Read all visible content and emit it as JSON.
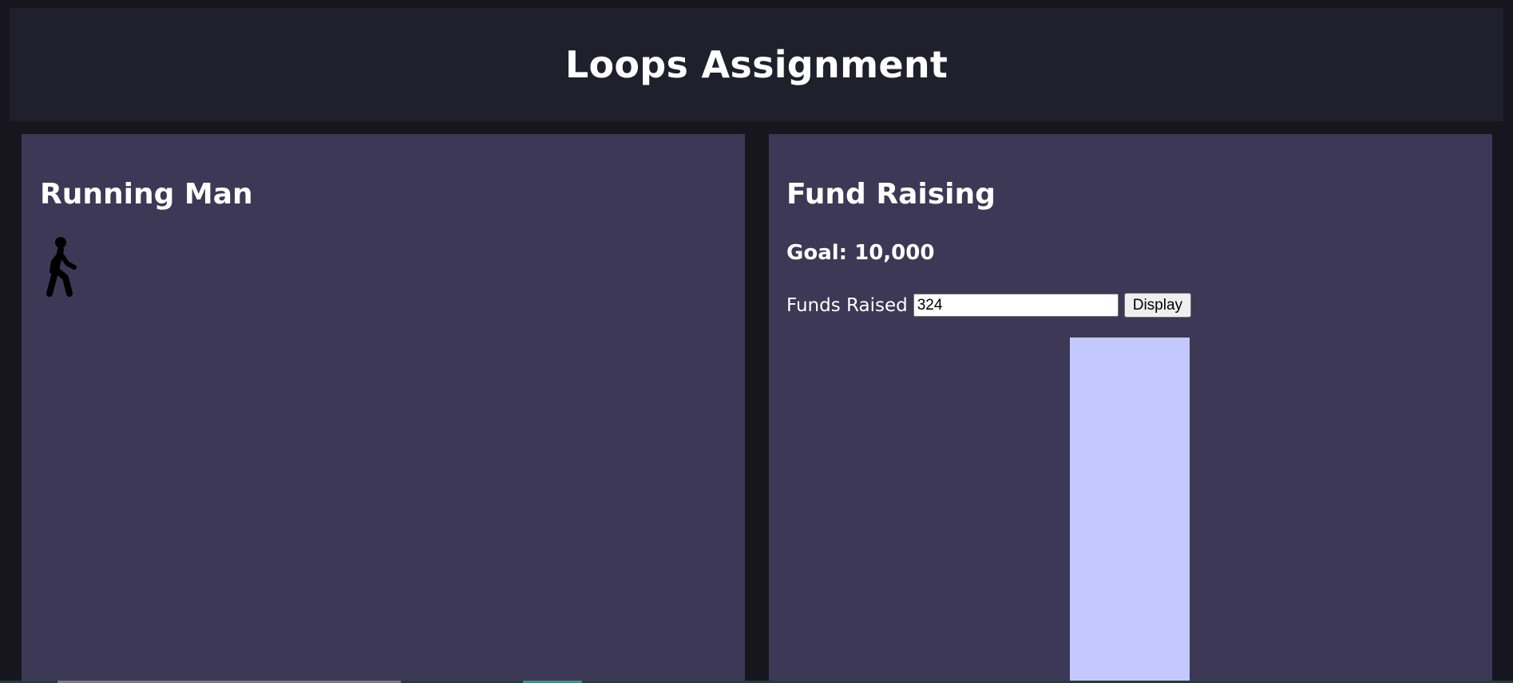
{
  "header": {
    "title": "Loops Assignment"
  },
  "running_man": {
    "heading": "Running Man",
    "icon": "walking-person-icon"
  },
  "fund_raising": {
    "heading": "Fund Raising",
    "goal_text": "Goal: 10,000",
    "funds_label": "Funds Raised",
    "funds_value": "324",
    "display_label": "Display",
    "progress_fraction": 1.0
  },
  "colors": {
    "page_bg": "#17161f",
    "header_bg": "#201f2c",
    "panel_bg": "#3c3855",
    "bar_fill": "#c3c9fc"
  }
}
